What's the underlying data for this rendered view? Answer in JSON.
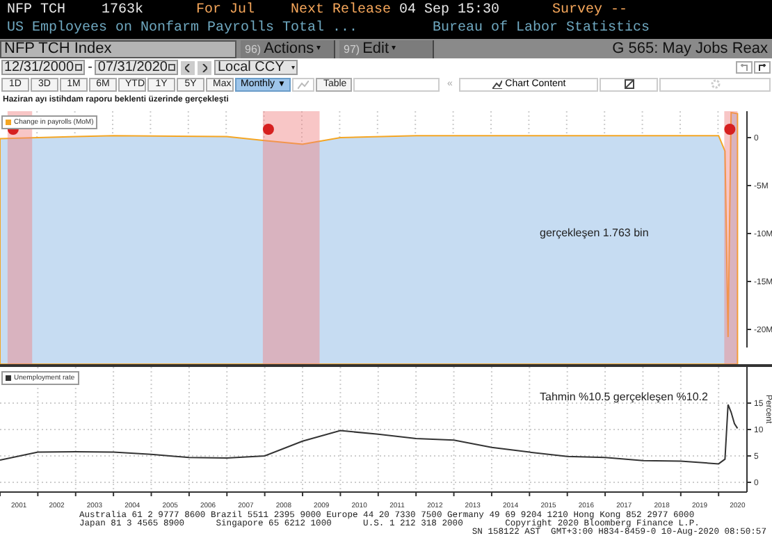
{
  "header": {
    "ticker": "NFP TCH",
    "value": "1763k",
    "period_label": "For Jul",
    "next_release_label": "Next Release",
    "next_release": "04 Sep 15:30",
    "survey_label": "Survey",
    "survey": "--",
    "description": "US Employees on Nonfarm Payrolls Total ...",
    "source": "Bureau of Labor Statistics"
  },
  "command_bar": {
    "security": "NFP TCH Index",
    "menus": [
      {
        "number": "96)",
        "label": "Actions",
        "caret": "▾"
      },
      {
        "number": "97)",
        "label": "Edit",
        "caret": "▾"
      }
    ],
    "page_title": "G 565: May Jobs Reax"
  },
  "date_bar": {
    "start": "12/31/2000",
    "separator": "-",
    "end": "07/31/2020",
    "currency": "Local CCY",
    "currency_caret": "▾"
  },
  "range_bar": {
    "periods": [
      "1D",
      "3D",
      "1M",
      "6M",
      "YTD",
      "1Y",
      "5Y",
      "Max"
    ],
    "frequency": "Monthly",
    "frequency_caret": "▼",
    "table": "Table",
    "collapse": "«",
    "chart_content": "Chart Content"
  },
  "chart_title": "Haziran ayı istihdam raporu beklenti üzerinde gerçekleşti",
  "payrolls_panel": {
    "legend": "Change in payrolls (MoM)",
    "annotation": "gerçekleşen 1.763 bin",
    "y_axis_labels": [
      "0",
      "-5M",
      "-10M",
      "-15M",
      "-20M"
    ]
  },
  "unemployment_panel": {
    "annotation": "Tahmin %10.5 gerçekleşen %10.2",
    "chart_data": {
      "type": "line",
      "ylabel": "Percent",
      "grid": true,
      "xlim": [
        2001.0,
        2020.75
      ],
      "x": [
        2001,
        2002,
        2003,
        2004,
        2005,
        2006,
        2007,
        2008,
        2009,
        2010,
        2011,
        2012,
        2013,
        2014,
        2015,
        2016,
        2017,
        2018,
        2019,
        2020,
        2020.17,
        2020.25,
        2020.33,
        2020.42,
        2020.5
      ],
      "series": [
        {
          "name": "Unemployment rate",
          "color": "#333333",
          "values": [
            4.2,
            5.7,
            5.8,
            5.7,
            5.3,
            4.7,
            4.6,
            5.0,
            7.8,
            9.8,
            9.1,
            8.3,
            8.0,
            6.6,
            5.7,
            4.9,
            4.7,
            4.1,
            4.0,
            3.5,
            4.4,
            14.7,
            13.3,
            11.1,
            10.2
          ]
        }
      ],
      "ylim": [
        -1.84,
        21.84
      ],
      "yticks": [
        0,
        5,
        10,
        15
      ],
      "xticks": [
        {
          "value": 2001.5,
          "label": "2001"
        },
        {
          "value": 2002.5,
          "label": "2002"
        },
        {
          "value": 2003.5,
          "label": "2003"
        },
        {
          "value": 2004.5,
          "label": "2004"
        },
        {
          "value": 2005.5,
          "label": "2005"
        },
        {
          "value": 2006.5,
          "label": "2006"
        },
        {
          "value": 2007.5,
          "label": "2007"
        },
        {
          "value": 2008.5,
          "label": "2008"
        },
        {
          "value": 2009.5,
          "label": "2009"
        },
        {
          "value": 2010.5,
          "label": "2010"
        },
        {
          "value": 2011.5,
          "label": "2011"
        },
        {
          "value": 2012.5,
          "label": "2012"
        },
        {
          "value": 2013.5,
          "label": "2013"
        },
        {
          "value": 2014.5,
          "label": "2014"
        },
        {
          "value": 2015.5,
          "label": "2015"
        },
        {
          "value": 2016.5,
          "label": "2016"
        },
        {
          "value": 2017.5,
          "label": "2017"
        },
        {
          "value": 2018.5,
          "label": "2018"
        },
        {
          "value": 2019.5,
          "label": "2019"
        },
        {
          "value": 2020.5,
          "label": "2020"
        }
      ]
    }
  },
  "footer": [
    "Australia 61 2 9777 8600 Brazil 5511 2395 9000 Europe 44 20 7330 7500 Germany 49 69 9204 1210 Hong Kong 852 2977 6000",
    "Japan 81 3 4565 8900      Singapore 65 6212 1000      U.S. 1 212 318 2000        Copyright 2020 Bloomberg Finance L.P.",
    "SN 158122 AST  GMT+3:00 H834-8459-0 10-Aug-2020 08:50:57"
  ]
}
